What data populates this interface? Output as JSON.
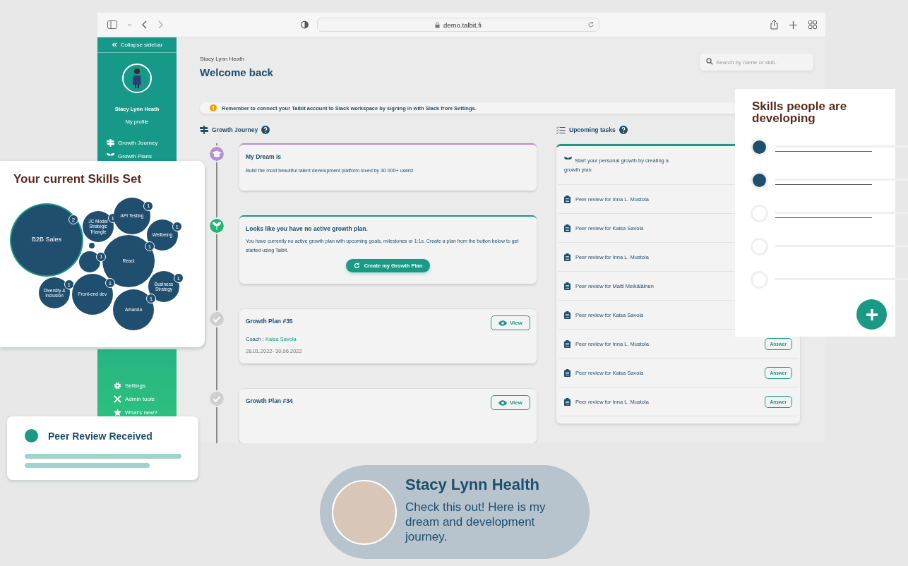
{
  "browser": {
    "url": "demo.talbit.fi"
  },
  "sidebar": {
    "collapse": "Collapse sidebar",
    "user_name": "Stacy Lynn Heath",
    "profile_link": "My profile",
    "nav_top": [
      {
        "label": "Growth Journey"
      },
      {
        "label": "Growth Plans"
      }
    ],
    "nav_bottom": [
      {
        "label": "Settings"
      },
      {
        "label": "Admin tools"
      },
      {
        "label": "What's new?"
      }
    ]
  },
  "header": {
    "user": "Stacy Lynn Heath",
    "title": "Welcome back",
    "search": {
      "placeholder": "Search by name or skill.."
    }
  },
  "alert": {
    "text": "Remember to connect your Talbit account to Slack workspace by signing in with Slack from Settings."
  },
  "growth_journey": {
    "title": "Growth Journey",
    "items": [
      {
        "kind": "dream",
        "title": "My Dream is",
        "text": "Build the most beautiful talent development platform loved by 30 000+ users!"
      },
      {
        "kind": "empty",
        "title": "Looks like you have no active growth plan.",
        "text": "You have currently no active growth plan with upcoming goals, milestones or 1:1s. Create a plan from the button below to get started using Talbit.",
        "button": "Create my Growth Plan"
      },
      {
        "kind": "plan",
        "title": "Growth Plan #35",
        "coach_label": "Coach :",
        "coach": "Kaisa Savola",
        "dates": "28.01.2022- 30.06.2022",
        "button": "View"
      },
      {
        "kind": "plan",
        "title": "Growth Plan #34",
        "button": "View"
      }
    ]
  },
  "upcoming_tasks": {
    "title": "Upcoming tasks",
    "tasks": [
      {
        "kind": "start",
        "text": "Start your personal growth by creating a growth plan"
      },
      {
        "kind": "review",
        "text": "Peer review for Inna L. Mustola"
      },
      {
        "kind": "review",
        "text": "Peer review for Kaisa Savola"
      },
      {
        "kind": "review",
        "text": "Peer review for Inna L. Mustola"
      },
      {
        "kind": "review",
        "text": "Peer review for Matti Meikäläinen"
      },
      {
        "kind": "review",
        "text": "Peer review for Kaisa Savola"
      },
      {
        "kind": "review",
        "text": "Peer review for Inna L. Mustola",
        "button": "Answer"
      },
      {
        "kind": "review",
        "text": "Peer review for Kaisa Savola",
        "button": "Answer"
      },
      {
        "kind": "review",
        "text": "Peer review for Inna L. Mustola",
        "button": "Answer"
      }
    ]
  },
  "skills_set_card": {
    "title": "Your current Skills Set",
    "skills": [
      {
        "label": "B2B Sales",
        "count": "2",
        "selected": true
      },
      {
        "label": "JC Model Strategic Triangle",
        "count": "1",
        "selected": false
      },
      {
        "label": "API Testing",
        "count": "1",
        "selected": false
      },
      {
        "label": "Wellbeing",
        "count": "1",
        "selected": false
      },
      {
        "label": "React",
        "count": "1",
        "selected": false
      },
      {
        "count": "1",
        "selected": false
      },
      {
        "label": "Business Strategy",
        "count": "1",
        "selected": false
      },
      {
        "label": "Diversity & Inclusion",
        "count": "1",
        "selected": false
      },
      {
        "label": "Front-end dev",
        "count": "1",
        "selected": false
      },
      {
        "label": "Amanda",
        "count": "1",
        "selected": false
      }
    ]
  },
  "skills_developing_card": {
    "title": "Skills people are developing",
    "rows": [
      {
        "checked": true
      },
      {
        "checked": true
      },
      {
        "checked": false
      },
      {
        "checked": false
      },
      {
        "checked": false
      }
    ]
  },
  "peer_review_card": {
    "title": "Peer Review Received"
  },
  "message_bubble": {
    "name": "Stacy Lynn Health",
    "text": "Check this out! Here is my dream and development journey."
  }
}
